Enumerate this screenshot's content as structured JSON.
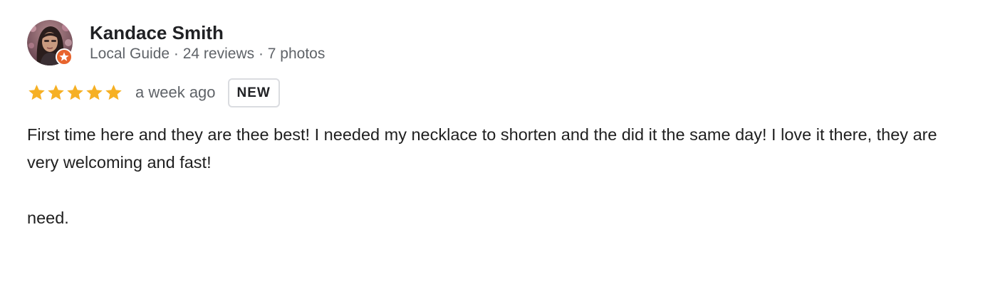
{
  "review": {
    "author_name": "Kandace Smith",
    "author_meta": "Local Guide · 24 reviews · 7 photos",
    "rating": 5,
    "rating_max": 5,
    "time": "a week ago",
    "badge": "NEW",
    "text": "First time here and they are thee best! I needed my necklace to shorten and the did it the same day! I love it there, they are very welcoming and fast!\n\nneed."
  },
  "icons": {
    "avatar": "profile-photo",
    "guide_badge": "local-guide-star-icon",
    "star": "star-icon"
  },
  "colors": {
    "star": "#f6b024",
    "guide_badge": "#e8642d",
    "meta_text": "#5f6368",
    "badge_border": "#dadce0"
  }
}
